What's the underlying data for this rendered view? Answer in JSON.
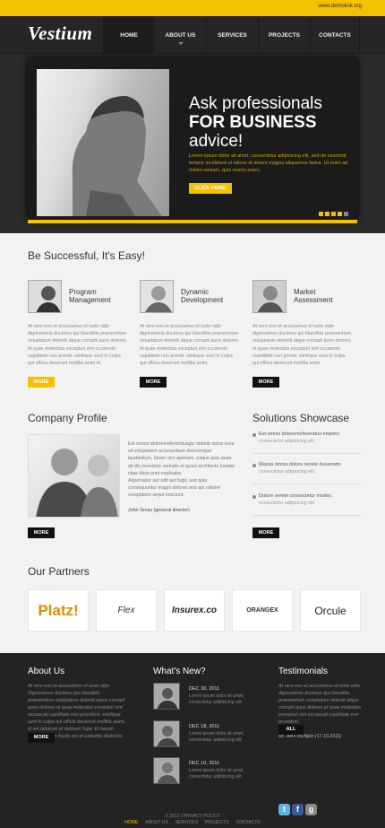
{
  "topbar": {
    "contact": "www.demolink.org"
  },
  "brand": {
    "logo": "Vestium"
  },
  "nav": [
    {
      "label": "HOME",
      "active": true
    },
    {
      "label": "ABOUT US",
      "active": false
    },
    {
      "label": "SERVICES",
      "active": false
    },
    {
      "label": "PROJECTS",
      "active": false
    },
    {
      "label": "CONTACTS",
      "active": false
    }
  ],
  "hero": {
    "line1": "Ask professionals",
    "line2": "FOR BUSINESS",
    "line3": "advice!",
    "text": "Lorem ipsum dolor sit amet, consectetur adipisicing elit, sed do eiusmod tempor incididunt ut labore et dolore magna aliquamus fadus. Ut enim ad minim veniam, quis nosrtu exerc.",
    "cta": "CLICK HERE!",
    "slides": 5,
    "current": 1
  },
  "services": {
    "heading": "Be Successful, It's Easy!",
    "items": [
      {
        "title": "Program Management",
        "text": "At vero eos et accusamus et iusto odio dignissimos ducimus qui blanditiis praesentium voluptatum deleniti atque corrupti quos dolores et quas molestias excepturi sint occaecati cupiditate non provid, similique sunt in culpa qui officia deserunt mollitia anim id.",
        "button": "MORE"
      },
      {
        "title": "Dynamic Development",
        "text": "At vero eos et accusamus et iusto odio dignissimos ducimus qui blanditiis praesentium voluptatum deleniti atque corrupti quos dolores et quas molestias excepturi sint occaecati cupiditate non provid, similique sunt in culpa qui officia deserunt mollitia anim.",
        "button": "MORE"
      },
      {
        "title": "Market Assessment",
        "text": "At vero eos et accusamus et iusto odio dignissimos ducimus qui blanditiis praesentium voluptatum deleniti atque corrupti quos dolores et quas molestias excepturi sint occaecati cupiditate non provid, similique sunt in culpa qui officia deserunt mollitia anim.",
        "button": "MORE"
      }
    ]
  },
  "profile": {
    "heading": "Company Profile",
    "p1": "Est omnis doloremeferendusgiu dolorib natus error sit voluptatem accusantium doloremque laudantium, totam rem aperiam, eaque ipsa quae ab illo inventore veritatis et quasi architecto beatae vitae dicta sunt explicabo.",
    "p2": "Aspernatur aut odit aut fugit, sed quia consequuntur magni dolores eos qui ratione voluptatem sequi nesciunt.",
    "signature": "John Gross (general director)",
    "button": "MORE"
  },
  "showcase": {
    "heading": "Solutions Showcase",
    "items": [
      {
        "title": "Est omnis doloremeferendus empeto",
        "text": "consectetur adipisicing elit."
      },
      {
        "title": "Massa omnis dolore serete ducemeto",
        "text": "consectetur adipisicing elit."
      },
      {
        "title": "Dolore serete consectetur modes",
        "text": "consectetur adipisicing elit."
      }
    ],
    "button": "MORE"
  },
  "partners": {
    "heading": "Our Partners",
    "logos": [
      "Platz!",
      "Flex",
      "Insurex.co",
      "ORANGEX",
      "Orcule"
    ]
  },
  "footer": {
    "about": {
      "heading": "About Us",
      "text": "At vero eos et accusamus et iusto odio. Dignissimos ducimus qui blanditiis praesentium voluptatum deleniti atque corrupti quos dolores et quas molestias excepturi sint occaecati cupiditate non provident, similique sunt in culpa qui officia deserunt mollitia animi, id est laborum et dolorum fuga. Et harum quidem rerum facilis est et expedita distinctio.",
      "button": "MORE"
    },
    "news": {
      "heading": "What's New?",
      "items": [
        {
          "date": "DEC 30, 2011",
          "text": "Lorem ipsum dolor sit amet, consectetur adipisicing elit."
        },
        {
          "date": "DEC 18, 2011",
          "text": "Lorem ipsum dolor sit amet, consectetur adipisicing elit."
        },
        {
          "date": "DEC 10, 2011",
          "text": "Lorem ipsum dolor sit amet, consectetur adipisicing elit."
        }
      ]
    },
    "testimonials": {
      "heading": "Testimonials",
      "text": "At vero eos et accusamus et iusto odio dignissimos ducimus qui blanditiis praesentium voluptatum deleniti atque corrupti quos dolores et quas molestias excepturi sint occaecati cupiditate non provident.",
      "author": "Mr. Alex McAlpin (17.10.2011)",
      "button": "ALL"
    },
    "copyright": "© 2012 | PRIVACY POLICY",
    "links": [
      "HOME",
      "ABOUT US",
      "SERVICES",
      "PROJECTS",
      "CONTACTS"
    ]
  },
  "colors": {
    "accent": "#f5c000",
    "dark": "#232323"
  }
}
